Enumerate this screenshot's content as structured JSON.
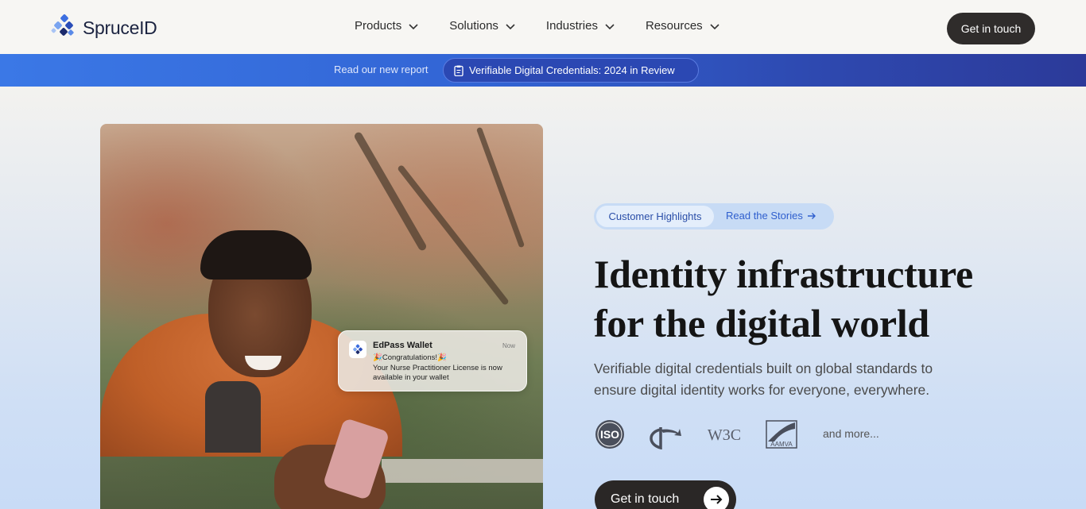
{
  "brand": {
    "name": "SpruceID"
  },
  "nav": {
    "items": [
      {
        "label": "Products"
      },
      {
        "label": "Solutions"
      },
      {
        "label": "Industries"
      },
      {
        "label": "Resources"
      }
    ],
    "cta": "Get in touch"
  },
  "banner": {
    "text": "Read our new report",
    "link": "Verifiable Digital Credentials: 2024 in Review"
  },
  "notification": {
    "app": "EdPass Wallet",
    "time": "Now",
    "line1": "🎉Congratulations!🎉",
    "line2": "Your Nurse Practitioner License is now available in your wallet"
  },
  "hero": {
    "tag": "Customer Highlights",
    "tag_link": "Read the Stories",
    "headline_line1": "Identity infrastructure",
    "headline_line2": "for the digital world",
    "subhead": "Verifiable digital credentials built on global standards to ensure digital identity works for everyone, everywhere.",
    "logos": [
      "ISO",
      "OpenID",
      "W3C",
      "AAMVA"
    ],
    "and_more": "and more...",
    "cta": "Get in touch"
  },
  "colors": {
    "accent": "#2f5fce",
    "dark_button": "#2a2726",
    "banner_start": "#3b78e6",
    "banner_end": "#2c3a99"
  }
}
